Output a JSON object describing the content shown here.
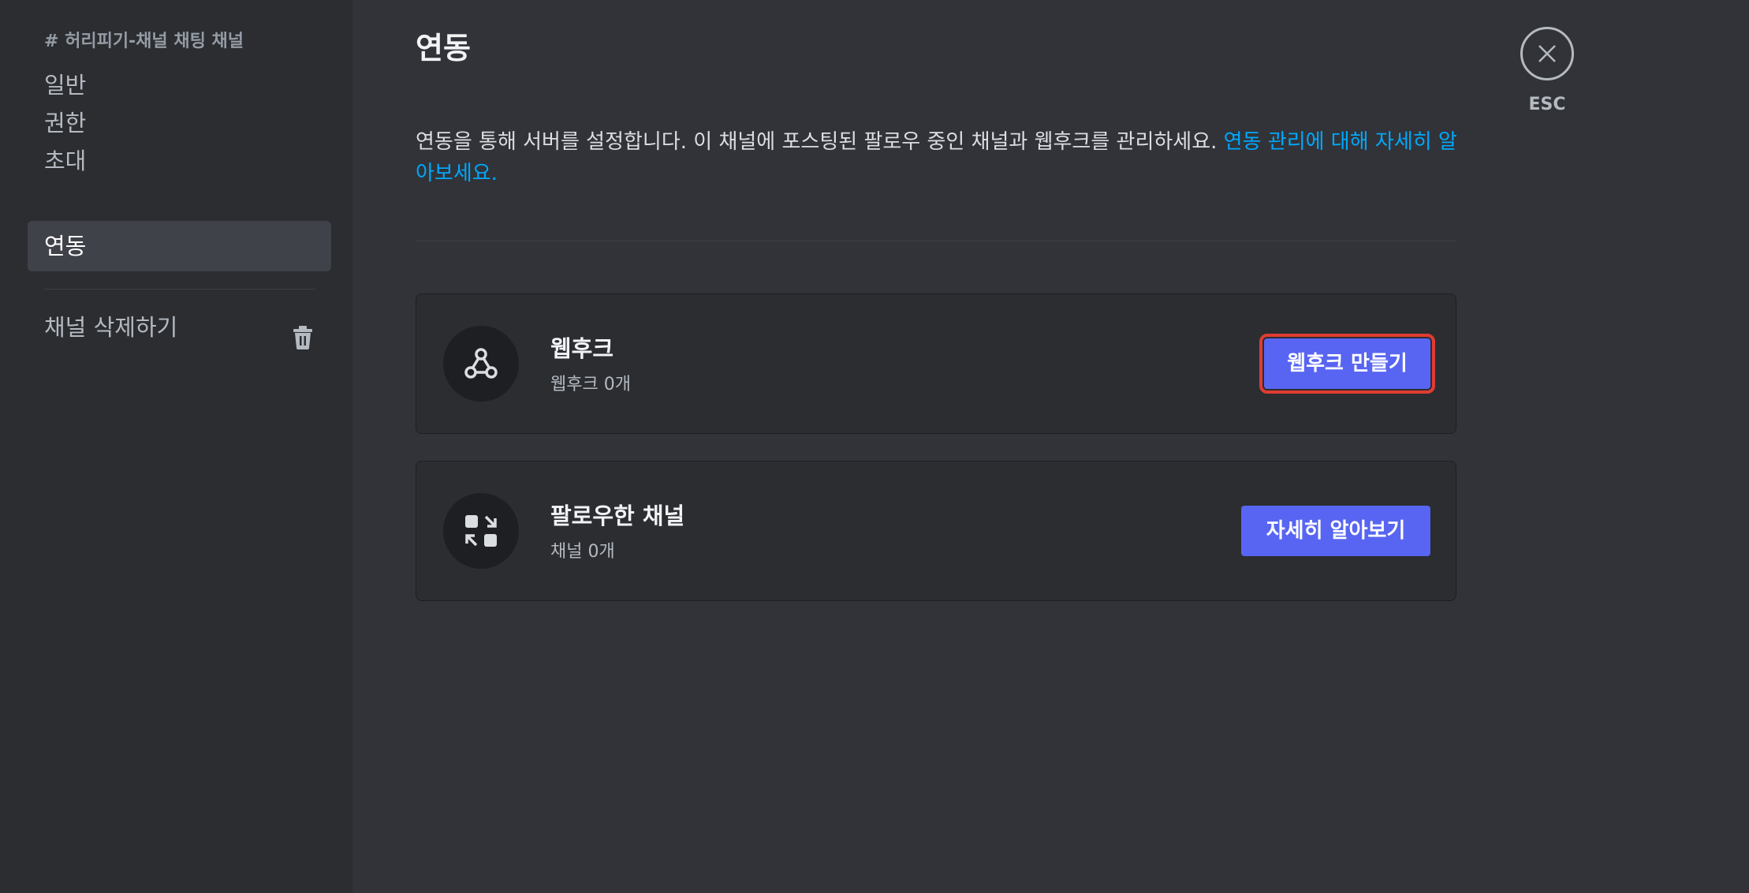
{
  "sidebar": {
    "channel_header": "# 허리피기-채널 채팅 채널",
    "items": [
      {
        "label": "일반"
      },
      {
        "label": "권한"
      },
      {
        "label": "초대"
      },
      {
        "label": "연동"
      }
    ],
    "selected_item": "연동",
    "delete_label": "채널 삭제하기"
  },
  "main": {
    "title": "연동",
    "description": "연동을 통해 서버를 설정합니다. 이 채널에 포스팅된 팔로우 중인 채널과 웹후크를 관리하세요.",
    "learn_more_link": "연동 관리에 대해 자세히 알아보세요.",
    "cards": [
      {
        "title": "웹후크",
        "subtitle": "웹후크 0개",
        "button_label": "웹후크 만들기",
        "icon": "webhook-icon"
      },
      {
        "title": "팔로우한 채널",
        "subtitle": "채널 0개",
        "button_label": "자세히 알아보기",
        "icon": "followed-channel-icon"
      }
    ]
  },
  "close": {
    "esc_label": "ESC"
  },
  "colors": {
    "background": "#313338",
    "sidebar": "#2b2d31",
    "accent": "#5865f2",
    "link": "#00a8fc",
    "highlight_outline": "#e03c31"
  }
}
